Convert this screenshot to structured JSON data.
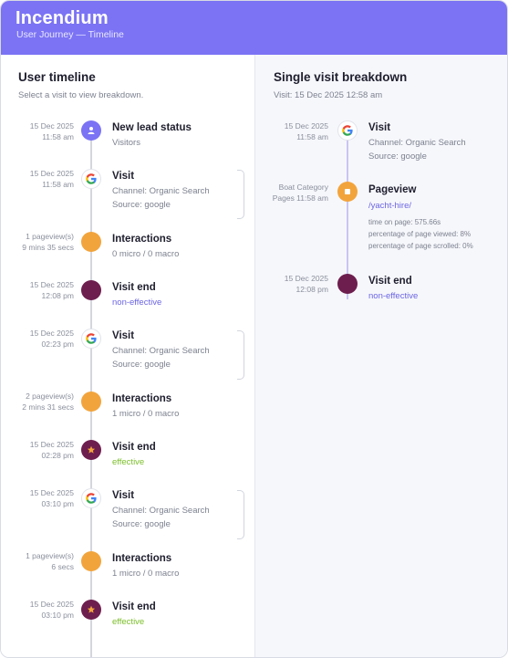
{
  "app": {
    "title": "Incendium",
    "subtitle": "User Journey — Timeline"
  },
  "left": {
    "title": "User timeline",
    "subtitle": "Select a visit to view breakdown.",
    "events": [
      {
        "type": "lead",
        "ts1": "15 Dec 2025",
        "ts2": "11:58 am",
        "title": "New lead status",
        "d1": "Visitors",
        "d2": "",
        "icon": "user-icon"
      },
      {
        "type": "visit",
        "ts1": "15 Dec 2025",
        "ts2": "11:58 am",
        "title": "Visit",
        "d1": "Channel: Organic Search",
        "d2": "Source: google",
        "icon": "google-icon"
      },
      {
        "type": "interactions",
        "ts1": "1 pageview(s)",
        "ts2": "9 mins 35 secs",
        "title": "Interactions",
        "d1": "0 micro / 0 macro",
        "d2": "",
        "icon": "circle-icon"
      },
      {
        "type": "end",
        "ts1": "15 Dec 2025",
        "ts2": "12:08 pm",
        "title": "Visit end",
        "d1": "non-effective",
        "d2": "",
        "icon": "dot-icon"
      },
      {
        "type": "visit",
        "ts1": "15 Dec 2025",
        "ts2": "02:23 pm",
        "title": "Visit",
        "d1": "Channel: Organic Search",
        "d2": "Source: google",
        "icon": "google-icon"
      },
      {
        "type": "interactions",
        "ts1": "2 pageview(s)",
        "ts2": "2 mins 31 secs",
        "title": "Interactions",
        "d1": "1 micro / 0 macro",
        "d2": "",
        "icon": "circle-icon"
      },
      {
        "type": "end-star",
        "ts1": "15 Dec 2025",
        "ts2": "02:28 pm",
        "title": "Visit end",
        "d1": "effective",
        "d2": "",
        "icon": "star-icon"
      },
      {
        "type": "visit",
        "ts1": "15 Dec 2025",
        "ts2": "03:10 pm",
        "title": "Visit",
        "d1": "Channel: Organic Search",
        "d2": "Source: google",
        "icon": "google-icon"
      },
      {
        "type": "interactions",
        "ts1": "1 pageview(s)",
        "ts2": "6 secs",
        "title": "Interactions",
        "d1": "1 micro / 0 macro",
        "d2": "",
        "icon": "circle-icon"
      },
      {
        "type": "end-star",
        "ts1": "15 Dec 2025",
        "ts2": "03:10 pm",
        "title": "Visit end",
        "d1": "effective",
        "d2": "",
        "icon": "star-icon"
      }
    ]
  },
  "right": {
    "title": "Single visit breakdown",
    "subtitle": "Visit: 15 Dec 2025 12:58 am",
    "visit": {
      "ts1": "15 Dec 2025",
      "ts2": "11:58 am",
      "title": "Visit",
      "d1": "Channel: Organic Search",
      "d2": "Source: google",
      "icon": "google-icon"
    },
    "pageview": {
      "ts1": "Boat Category",
      "ts2": "Pages 11:58 am",
      "title": "Pageview",
      "path": "/yacht-hire/",
      "m1": "time on page: 575.66s",
      "m2": "percentage of page viewed: 8%",
      "m3": "percentage of page scrolled: 0%",
      "icon": "square-icon"
    },
    "end": {
      "ts1": "15 Dec 2025",
      "ts2": "12:08 pm",
      "title": "Visit end",
      "d1": "non-effective",
      "icon": "dot-icon"
    }
  },
  "colors": {
    "header": "#7b73f4",
    "accent": "#6b64e3",
    "orange": "#f2a43c",
    "end": "#6d1e4e",
    "effective": "#7cbe2a"
  }
}
